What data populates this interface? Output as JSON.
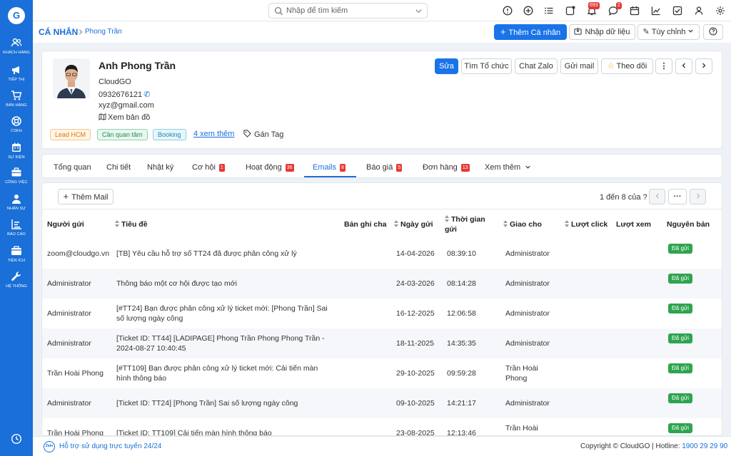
{
  "sidebar": {
    "logo": "G",
    "items": [
      {
        "label": "KHÁCH HÀNG",
        "icon": "users-icon"
      },
      {
        "label": "TIẾP THỊ",
        "icon": "megaphone-icon"
      },
      {
        "label": "BÁN HÀNG",
        "icon": "cart-icon"
      },
      {
        "label": "CSKH",
        "icon": "support-icon"
      },
      {
        "label": "SỰ KIỆN",
        "icon": "calendar-icon"
      },
      {
        "label": "CÔNG VIỆC",
        "icon": "briefcase-icon"
      },
      {
        "label": "NHÂN SỰ",
        "icon": "person-icon"
      },
      {
        "label": "BÁO CÁO",
        "icon": "report-icon"
      },
      {
        "label": "TIỆN ÍCH",
        "icon": "utility-icon"
      },
      {
        "label": "HỆ THỐNG",
        "icon": "wrench-icon"
      }
    ]
  },
  "topbar": {
    "search_placeholder": "Nhập để tìm kiếm",
    "notification_count": "693",
    "chat_count": "2"
  },
  "breadcrumb": {
    "section": "CÁ NHÂN",
    "current": "Phong Trần"
  },
  "actions": {
    "add": "Thêm Cá nhân",
    "import": "Nhập dữ liệu",
    "customize": "Tùy chỉnh"
  },
  "profile": {
    "name": "Anh Phong Trần",
    "company": "CloudGO",
    "phone": "0932676121",
    "email": "xyz@gmail.com",
    "map": "Xem bản đồ",
    "tags": [
      "Lead HCM",
      "Cần quan tâm",
      "Booking"
    ],
    "more_tags": "4  xem thêm",
    "assign_tag": "Gán Tag",
    "buttons": {
      "edit": "Sửa",
      "find_org": "Tìm Tổ chức",
      "chat_zalo": "Chat Zalo",
      "send_mail": "Gửi mail",
      "follow": "Theo dõi"
    }
  },
  "tabs": [
    {
      "label": "Tổng quan",
      "badge": ""
    },
    {
      "label": "Chi tiết",
      "badge": ""
    },
    {
      "label": "Nhật ký",
      "badge": ""
    },
    {
      "label": "Cơ hội",
      "badge": "1"
    },
    {
      "label": "Hoạt động",
      "badge": "36"
    },
    {
      "label": "Emails",
      "badge": "8"
    },
    {
      "label": "Báo giá",
      "badge": "5"
    },
    {
      "label": "Đơn hàng",
      "badge": "13"
    },
    {
      "label": "Xem thêm",
      "badge": ""
    }
  ],
  "emails": {
    "add_mail": "Thêm Mail",
    "pagination": "1 đến 8 của",
    "columns": [
      "Người gửi",
      "Tiêu đề",
      "Bản ghi cha",
      "Ngày gửi",
      "Thời gian gửi",
      "Giao cho",
      "Lượt click",
      "Lượt xem",
      "Nguyên bản"
    ],
    "rows": [
      {
        "sender": "zoom@cloudgo.vn",
        "subject": "[TB] Yêu cầu hỗ trợ số TT24 đã được phân công xử lý",
        "date": "14-04-2026",
        "time": "08:39:10",
        "assignee": "Administrator",
        "status": "Đã gửi"
      },
      {
        "sender": "Administrator",
        "subject": "Thông báo một cơ hội được tạo mới",
        "date": "24-03-2026",
        "time": "08:14:28",
        "assignee": "Administrator",
        "status": "Đã gửi"
      },
      {
        "sender": "Administrator",
        "subject": "[#TT24] Bạn được phân công xử lý ticket mới: [Phong Trần] Sai số lượng ngày công",
        "date": "16-12-2025",
        "time": "12:06:58",
        "assignee": "Administrator",
        "status": "Đã gửi"
      },
      {
        "sender": "Administrator",
        "subject": "[Ticket ID: TT44] [LADIPAGE] Phong Trần Phong Phong Trần - 2024-08-27 10:40:45",
        "date": "18-11-2025",
        "time": "14:35:35",
        "assignee": "Administrator",
        "status": "Đã gửi"
      },
      {
        "sender": "Trần Hoài Phong",
        "subject": "[#TT109] Bạn được phân công xử lý ticket mới: Cải tiến màn hình thông báo",
        "date": "29-10-2025",
        "time": "09:59:28",
        "assignee": "Trần Hoài Phong",
        "status": "Đã gửi"
      },
      {
        "sender": "Administrator",
        "subject": "[Ticket ID: TT24] [Phong Trần] Sai số lượng ngày công",
        "date": "09-10-2025",
        "time": "14:21:17",
        "assignee": "Administrator",
        "status": "Đã gửi"
      },
      {
        "sender": "Trần Hoài Phong",
        "subject": "[Ticket ID: TT109] Cải tiến màn hình thông báo",
        "date": "23-08-2025",
        "time": "12:13:46",
        "assignee": "Trần Hoài",
        "status": "Đã gửi"
      }
    ]
  },
  "footer": {
    "support": "Hỗ trợ sử dụng trực tuyến 24/24",
    "copyright": "Copyright © CloudGO | Hotline: ",
    "hotline": "1900 29 29 90"
  },
  "colors": {
    "brand": "#1a6fd8",
    "primary_button": "#1a73e8",
    "badge": "#e53935",
    "sent": "#2ea44f"
  }
}
